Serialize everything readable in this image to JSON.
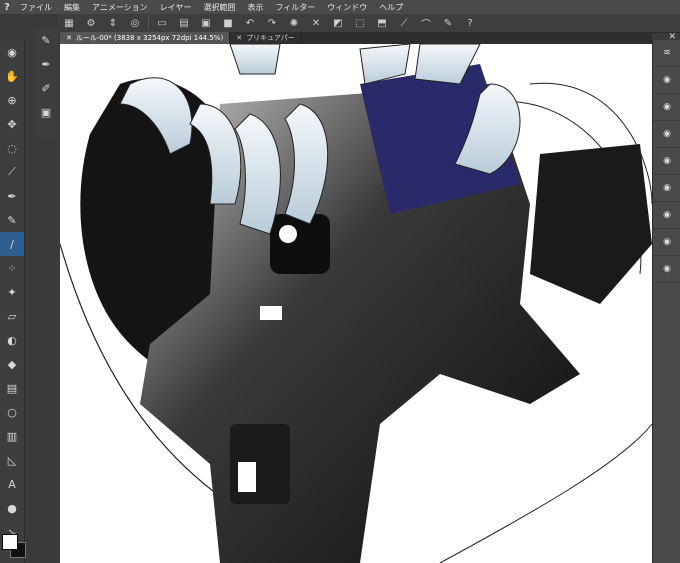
{
  "menu": [
    "ファイル",
    "編集",
    "アニメーション",
    "レイヤー",
    "選択範囲",
    "表示",
    "フィルター",
    "ウィンドウ",
    "ヘルプ"
  ],
  "tabs": [
    {
      "label": "ルール-00* (3838 x 3254px 72dpi 144.5%)",
      "active": true
    },
    {
      "label": "プリキュアパー",
      "active": false
    }
  ],
  "app_icon": "?",
  "tools_left": [
    "magnifier-icon",
    "hand-icon",
    "zoom-icon",
    "move-icon",
    "lasso-icon",
    "eyedropper-icon",
    "pen-icon",
    "pencil-icon",
    "brush-icon",
    "airbrush-icon",
    "decorate-icon",
    "eraser-icon",
    "blend-icon",
    "fill-icon",
    "gradient-icon",
    "figure-icon",
    "frame-icon",
    "ruler-icon",
    "text-icon",
    "balloon-icon",
    "correct-line-icon"
  ],
  "tools_sub": [
    "pen-sub-icon",
    "pen-sub2-icon",
    "marker-sub-icon",
    "transparent-sub-icon"
  ],
  "right_layers": 8,
  "colors": {
    "accent": "#2f5f8f",
    "panel": "#3d3d3d",
    "canvas": "#ffffff"
  }
}
